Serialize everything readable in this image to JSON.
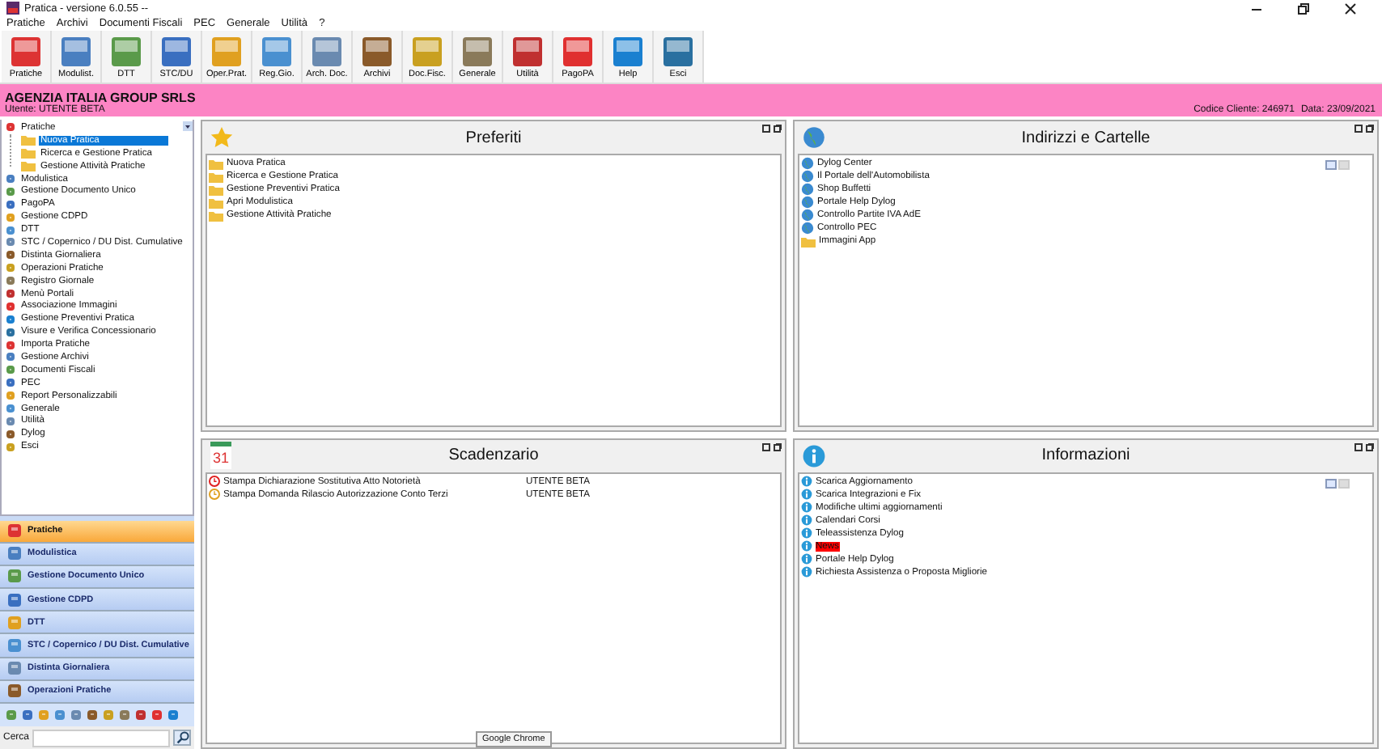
{
  "window": {
    "title": "Pratica - versione 6.0.55 --"
  },
  "menu": [
    "Pratiche",
    "Archivi",
    "Documenti Fiscali",
    "PEC",
    "Generale",
    "Utilità",
    "?"
  ],
  "toolbar": [
    {
      "label": "Pratiche"
    },
    {
      "label": "Modulist."
    },
    {
      "label": "DTT"
    },
    {
      "label": "STC/DU"
    },
    {
      "label": "Oper.Prat."
    },
    {
      "label": "Reg.Gio."
    },
    {
      "label": "Arch. Doc."
    },
    {
      "label": "Archivi"
    },
    {
      "label": "Doc.Fisc."
    },
    {
      "label": "Generale"
    },
    {
      "label": "Utilità"
    },
    {
      "label": "PagoPA"
    },
    {
      "label": "Help"
    },
    {
      "label": "Esci"
    }
  ],
  "header": {
    "company": "AGENZIA ITALIA GROUP SRLS",
    "user": "Utente: UTENTE BETA",
    "client_code": "Codice Cliente: 246971",
    "date": "Data: 23/09/2021"
  },
  "tree": [
    {
      "label": "Pratiche",
      "selected": false,
      "expanded": true,
      "children": [
        {
          "label": "Nuova Pratica",
          "selected": true
        },
        {
          "label": "Ricerca e Gestione Pratica",
          "selected": false
        },
        {
          "label": "Gestione Attività Pratiche",
          "selected": false
        }
      ]
    },
    {
      "label": "Modulistica",
      "selected": false
    },
    {
      "label": "Gestione Documento Unico",
      "selected": false
    },
    {
      "label": "PagoPA",
      "selected": false
    },
    {
      "label": "Gestione CDPD",
      "selected": false
    },
    {
      "label": "DTT",
      "selected": false
    },
    {
      "label": "STC / Copernico / DU Dist. Cumulative",
      "selected": false
    },
    {
      "label": "Distinta Giornaliera",
      "selected": false
    },
    {
      "label": "Operazioni Pratiche",
      "selected": false
    },
    {
      "label": "Registro Giornale",
      "selected": false
    },
    {
      "label": "Menù Portali",
      "selected": false
    },
    {
      "label": "Associazione Immagini",
      "selected": false
    },
    {
      "label": "Gestione Preventivi Pratica",
      "selected": false
    },
    {
      "label": "Visure e Verifica Concessionario",
      "selected": false
    },
    {
      "label": "Importa Pratiche",
      "selected": false
    },
    {
      "label": "Gestione Archivi",
      "selected": false
    },
    {
      "label": "Documenti Fiscali",
      "selected": false
    },
    {
      "label": "PEC",
      "selected": false
    },
    {
      "label": "Report Personalizzabili",
      "selected": false
    },
    {
      "label": "Generale",
      "selected": false
    },
    {
      "label": "Utilità",
      "selected": false
    },
    {
      "label": "Dylog",
      "selected": false
    },
    {
      "label": "Esci",
      "selected": false
    }
  ],
  "nav_buttons": [
    {
      "label": "Pratiche",
      "selected": true
    },
    {
      "label": "Modulistica",
      "selected": false
    },
    {
      "label": "Gestione Documento Unico",
      "selected": false
    },
    {
      "label": "Gestione CDPD",
      "selected": false
    },
    {
      "label": "DTT",
      "selected": false
    },
    {
      "label": "STC / Copernico / DU Dist. Cumulative",
      "selected": false
    },
    {
      "label": "Distinta Giornaliera",
      "selected": false
    },
    {
      "label": "Operazioni Pratiche",
      "selected": false
    }
  ],
  "search": {
    "label": "Cerca"
  },
  "panels": [
    {
      "title": "Preferiti",
      "kind": "list",
      "items": [
        {
          "label": "Nuova Pratica"
        },
        {
          "label": "Ricerca e Gestione Pratica"
        },
        {
          "label": "Gestione Preventivi Pratica"
        },
        {
          "label": "Apri Modulistica"
        },
        {
          "label": "Gestione Attività Pratiche"
        }
      ]
    },
    {
      "title": "Indirizzi e Cartelle",
      "kind": "list",
      "items": [
        {
          "label": "Dylog Center"
        },
        {
          "label": "Il Portale dell'Automobilista"
        },
        {
          "label": "Shop Buffetti"
        },
        {
          "label": "Portale Help Dylog"
        },
        {
          "label": "Controllo Partite IVA AdE"
        },
        {
          "label": "Controllo PEC"
        },
        {
          "label": "Immagini App"
        }
      ]
    },
    {
      "title": "Scadenzario",
      "kind": "deadlines",
      "calendar_day": "31",
      "items": [
        {
          "label": "Stampa Dichiarazione Sostitutiva Atto Notorietà",
          "user": "UTENTE BETA",
          "color": "#e02020"
        },
        {
          "label": "Stampa Domanda Rilascio Autorizzazione Conto Terzi",
          "user": "UTENTE BETA",
          "color": "#e0a020"
        }
      ]
    },
    {
      "title": "Informazioni",
      "kind": "list",
      "items": [
        {
          "label": "Scarica Aggiornamento",
          "highlighted": false
        },
        {
          "label": "Scarica Integrazioni e Fix",
          "highlighted": false
        },
        {
          "label": "Modifiche ultimi aggiornamenti",
          "highlighted": false
        },
        {
          "label": "Calendari Corsi",
          "highlighted": false
        },
        {
          "label": "Teleassistenza Dylog",
          "highlighted": false
        },
        {
          "label": "News",
          "highlighted": true
        },
        {
          "label": "Portale Help Dylog",
          "highlighted": false
        },
        {
          "label": "Richiesta Assistenza o Proposta Migliorie",
          "highlighted": false
        }
      ]
    }
  ],
  "tooltip": "Google Chrome"
}
